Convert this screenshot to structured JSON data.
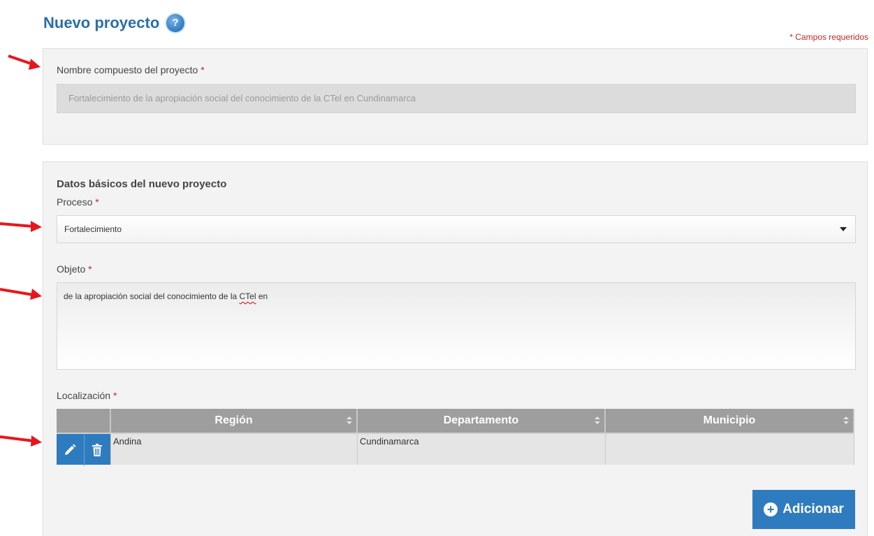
{
  "header": {
    "title": "Nuevo proyecto",
    "help_glyph": "?",
    "required_note": "* Campos requeridos"
  },
  "project_name": {
    "label": "Nombre compuesto del proyecto",
    "required_mark": "*",
    "value": "Fortalecimiento de la apropiación social del conocimiento de la CTel en  Cundinamarca"
  },
  "basic_data": {
    "section_title": "Datos básicos del nuevo proyecto",
    "proceso": {
      "label": "Proceso",
      "required_mark": "*",
      "selected": "Fortalecimiento"
    },
    "objeto": {
      "label": "Objeto",
      "required_mark": "*",
      "value_before": "de la apropiación social del conocimiento de la ",
      "value_misspelled": "CTel",
      "value_after": " en"
    },
    "localizacion": {
      "label": "Localización",
      "required_mark": "*",
      "columns": [
        "Región",
        "Departamento",
        "Municipio"
      ],
      "rows": [
        {
          "region": "Andina",
          "departamento": "Cundinamarca",
          "municipio": ""
        }
      ]
    },
    "add_button_label": "Adicionar"
  },
  "colors": {
    "title_blue": "#2a6fa8",
    "action_blue": "#2f7bbf",
    "required_red": "#c62828",
    "annotation_arrow": "#e8161c"
  },
  "icons": {
    "help": "question-circle-icon",
    "edit": "pencil-icon",
    "delete": "trash-icon",
    "add": "plus-circle-icon",
    "sort": "sort-icon",
    "dropdown": "caret-down-icon",
    "annotation": "red-arrow-icon"
  }
}
